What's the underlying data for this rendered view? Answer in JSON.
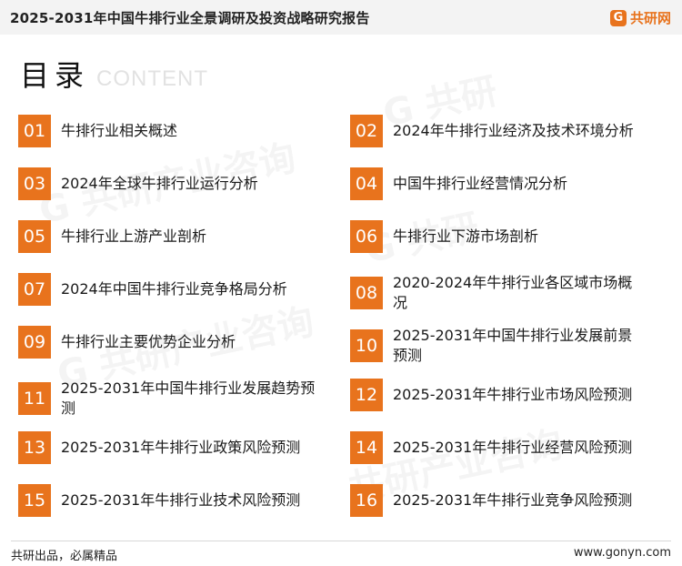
{
  "header": {
    "report_title": "2025-2031年中国牛排行业全景调研及投资战略研究报告",
    "logo_text": "共研网",
    "logo_mark": "G"
  },
  "section": {
    "title": "目录",
    "title_en": "CONTENT"
  },
  "toc": [
    {
      "num": "01",
      "label": "牛排行业相关概述"
    },
    {
      "num": "02",
      "label": "2024年牛排行业经济及技术环境分析"
    },
    {
      "num": "03",
      "label": "2024年全球牛排行业运行分析"
    },
    {
      "num": "04",
      "label": "中国牛排行业经营情况分析"
    },
    {
      "num": "05",
      "label": "牛排行业上游产业剖析"
    },
    {
      "num": "06",
      "label": "牛排行业下游市场剖析"
    },
    {
      "num": "07",
      "label": "2024年中国牛排行业竞争格局分析"
    },
    {
      "num": "08",
      "label": "2020-2024年牛排行业各区域市场概况"
    },
    {
      "num": "09",
      "label": "牛排行业主要优势企业分析"
    },
    {
      "num": "10",
      "label": "2025-2031年中国牛排行业发展前景预测"
    },
    {
      "num": "11",
      "label": "2025-2031年中国牛排行业发展趋势预测"
    },
    {
      "num": "12",
      "label": "2025-2031年牛排行业市场风险预测"
    },
    {
      "num": "13",
      "label": "2025-2031年牛排行业政策风险预测"
    },
    {
      "num": "14",
      "label": "2025-2031年牛排行业经营风险预测"
    },
    {
      "num": "15",
      "label": "2025-2031年牛排行业技术风险预测"
    },
    {
      "num": "16",
      "label": "2025-2031年牛排行业竞争风险预测"
    }
  ],
  "footer": {
    "slogan": "共研出品，必属精品",
    "website": "www.gonyn.com"
  },
  "colors": {
    "accent": "#e8731d",
    "header_bg": "#f3f3f3"
  }
}
